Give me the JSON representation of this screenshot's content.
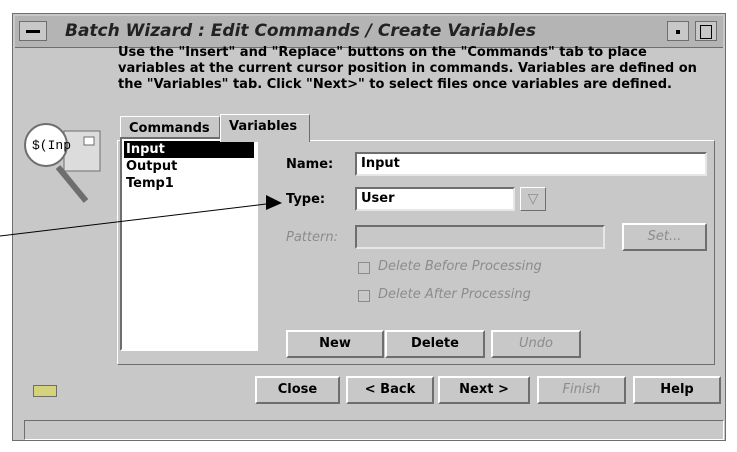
{
  "window": {
    "title": "Batch Wizard : Edit Commands / Create Variables",
    "instructions": "Use the \"Insert\" and \"Replace\" buttons on the \"Commands\" tab to place\nvariables at the current cursor position in commands. Variables are defined on\nthe \"Variables\" tab. Click \"Next>\" to select files once variables are defined."
  },
  "icon": {
    "name": "magnifier-icon",
    "text": "$(Inp"
  },
  "tabs": [
    {
      "label": "Commands"
    },
    {
      "label": "Variables"
    }
  ],
  "variables": {
    "list": [
      "Input",
      "Output",
      "Temp1"
    ],
    "selected_index": 0,
    "name_label": "Name:",
    "name_value": "Input",
    "type_label": "Type:",
    "type_value": "User",
    "pattern_label": "Pattern:",
    "pattern_value": "",
    "set_label": "Set...",
    "delete_before": "Delete Before Processing",
    "delete_after": "Delete After Processing",
    "new_label": "New",
    "delete_label": "Delete",
    "undo_label": "Undo"
  },
  "footer": {
    "close": "Close",
    "back": "< Back",
    "next": "Next >",
    "finish": "Finish",
    "help": "Help"
  },
  "colors": {
    "window": "#c8c8c8",
    "field": "#ffffff",
    "selected": "#000000"
  }
}
